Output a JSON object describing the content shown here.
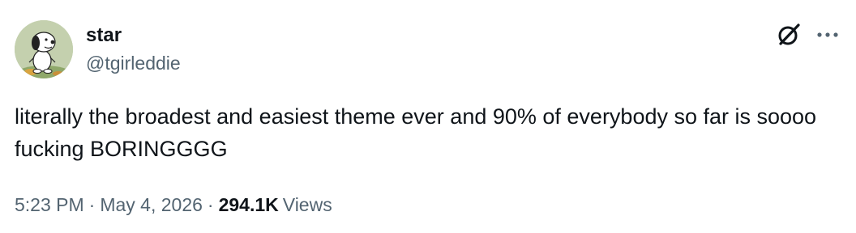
{
  "tweet": {
    "author": {
      "display_name": "star",
      "handle": "@tgirleddie",
      "avatar_icon": "snoopy-avatar"
    },
    "text": "literally the broadest and easiest theme ever and 90% of everybody so far is soooo fucking BORINGGGG",
    "time": "5:23 PM",
    "date": "May 4, 2026",
    "separator": "·",
    "views_count": "294.1K",
    "views_label": "Views"
  },
  "icons": {
    "grok": "grok-icon",
    "more": "more-options-icon"
  },
  "colors": {
    "text_primary": "#0f1419",
    "text_secondary": "#536471",
    "background": "#ffffff"
  }
}
